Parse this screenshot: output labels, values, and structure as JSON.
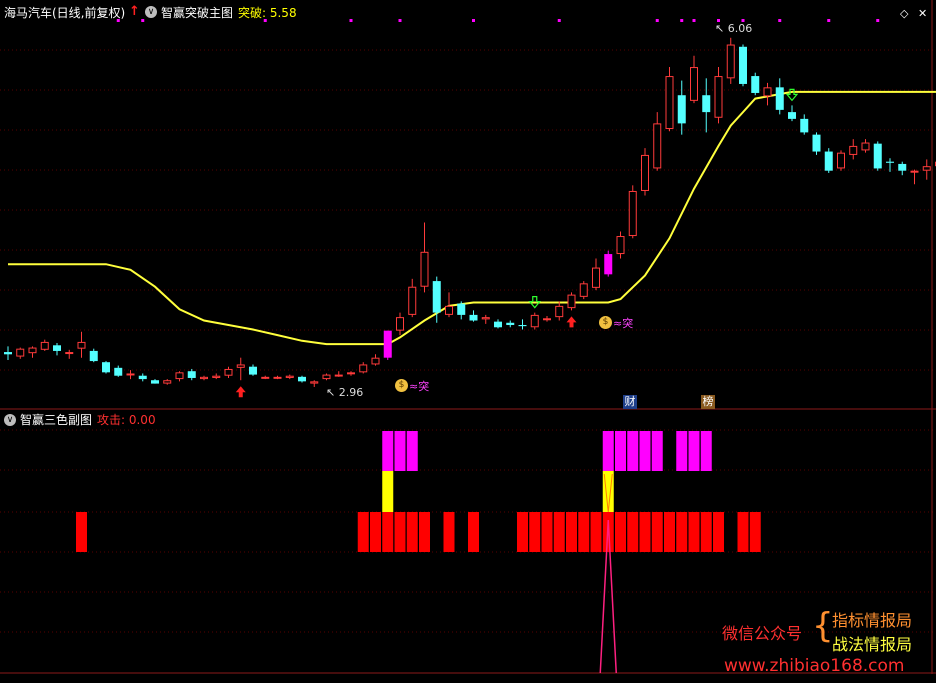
{
  "colors": {
    "background": "#000000",
    "grid": "#5a0000",
    "border": "#8b1a1a",
    "up": "#ff3b3b",
    "down": "#54ffff",
    "ma_line": "#ffff3c",
    "magenta": "#ff00ff",
    "yellow": "#ffff00",
    "red_bar": "#ff0000",
    "header_text": "#ffffff",
    "breakout_label": "#ffff00",
    "attack_label": "#ff3030"
  },
  "main_panel": {
    "stock_title": "海马汽车(日线,前复权)",
    "title_arrow_icon": "red-up-arrow-icon",
    "indicator_name": "智赢突破主图",
    "breakout_label": "突破: 5.58",
    "high_label": "6.06",
    "low_label": "2.96",
    "signal_text": "突",
    "signal_icon": "money-bag-icon",
    "event_cai": "财",
    "event_bang": "榜",
    "controls": [
      "◇",
      "✕"
    ]
  },
  "sub_panel": {
    "indicator_name": "智赢三色副图",
    "attack_label": "攻击: 0.00"
  },
  "watermark": {
    "channel_label": "微信公众号",
    "name_1": "指标情报局",
    "name_2": "战法情报局",
    "url": "www.zhibiao168.com"
  },
  "chart_data": [
    {
      "type": "candlestick",
      "title": "智赢突破主图",
      "subject": "海马汽车(日线,前复权)",
      "ylim": [
        2.8,
        6.2
      ],
      "annotations": [
        {
          "text": "6.06",
          "value": 6.06,
          "kind": "high"
        },
        {
          "text": "2.96",
          "value": 2.96,
          "kind": "low"
        }
      ],
      "candles": [
        {
          "o": 3.27,
          "h": 3.32,
          "l": 3.2,
          "c": 3.25
        },
        {
          "o": 3.23,
          "h": 3.31,
          "l": 3.21,
          "c": 3.3
        },
        {
          "o": 3.26,
          "h": 3.32,
          "l": 3.22,
          "c": 3.31
        },
        {
          "o": 3.29,
          "h": 3.38,
          "l": 3.28,
          "c": 3.36
        },
        {
          "o": 3.33,
          "h": 3.35,
          "l": 3.24,
          "c": 3.28
        },
        {
          "o": 3.26,
          "h": 3.29,
          "l": 3.21,
          "c": 3.27
        },
        {
          "o": 3.3,
          "h": 3.45,
          "l": 3.22,
          "c": 3.36
        },
        {
          "o": 3.28,
          "h": 3.3,
          "l": 3.18,
          "c": 3.19
        },
        {
          "o": 3.18,
          "h": 3.19,
          "l": 3.08,
          "c": 3.09
        },
        {
          "o": 3.13,
          "h": 3.15,
          "l": 3.05,
          "c": 3.06
        },
        {
          "o": 3.08,
          "h": 3.11,
          "l": 3.03,
          "c": 3.08
        },
        {
          "o": 3.06,
          "h": 3.08,
          "l": 3.01,
          "c": 3.03
        },
        {
          "o": 3.02,
          "h": 3.03,
          "l": 2.99,
          "c": 2.99
        },
        {
          "o": 2.99,
          "h": 3.03,
          "l": 2.98,
          "c": 3.02
        },
        {
          "o": 3.03,
          "h": 3.1,
          "l": 3.01,
          "c": 3.09
        },
        {
          "o": 3.1,
          "h": 3.12,
          "l": 3.02,
          "c": 3.04
        },
        {
          "o": 3.03,
          "h": 3.06,
          "l": 3.02,
          "c": 3.05
        },
        {
          "o": 3.04,
          "h": 3.08,
          "l": 3.03,
          "c": 3.06
        },
        {
          "o": 3.06,
          "h": 3.14,
          "l": 3.04,
          "c": 3.12
        },
        {
          "o": 3.13,
          "h": 3.22,
          "l": 3.02,
          "c": 3.16
        },
        {
          "o": 3.14,
          "h": 3.16,
          "l": 3.06,
          "c": 3.07
        },
        {
          "o": 3.05,
          "h": 3.06,
          "l": 3.03,
          "c": 3.05
        },
        {
          "o": 3.05,
          "h": 3.06,
          "l": 3.03,
          "c": 3.05
        },
        {
          "o": 3.04,
          "h": 3.07,
          "l": 3.03,
          "c": 3.06
        },
        {
          "o": 3.05,
          "h": 3.06,
          "l": 3.0,
          "c": 3.01
        },
        {
          "o": 2.99,
          "h": 3.02,
          "l": 2.96,
          "c": 3.01
        },
        {
          "o": 3.03,
          "h": 3.08,
          "l": 3.02,
          "c": 3.07
        },
        {
          "o": 3.07,
          "h": 3.1,
          "l": 3.05,
          "c": 3.07
        },
        {
          "o": 3.08,
          "h": 3.1,
          "l": 3.06,
          "c": 3.09
        },
        {
          "o": 3.09,
          "h": 3.18,
          "l": 3.08,
          "c": 3.16
        },
        {
          "o": 3.16,
          "h": 3.25,
          "l": 3.15,
          "c": 3.22
        },
        {
          "o": 3.22,
          "h": 3.46,
          "l": 3.2,
          "c": 3.46,
          "hl": "magenta"
        },
        {
          "o": 3.46,
          "h": 3.62,
          "l": 3.42,
          "c": 3.58
        },
        {
          "o": 3.6,
          "h": 3.92,
          "l": 3.58,
          "c": 3.85
        },
        {
          "o": 3.85,
          "h": 4.42,
          "l": 3.8,
          "c": 4.16
        },
        {
          "o": 3.9,
          "h": 3.94,
          "l": 3.53,
          "c": 3.62
        },
        {
          "o": 3.6,
          "h": 3.8,
          "l": 3.58,
          "c": 3.68
        },
        {
          "o": 3.7,
          "h": 3.72,
          "l": 3.56,
          "c": 3.6
        },
        {
          "o": 3.6,
          "h": 3.64,
          "l": 3.54,
          "c": 3.55
        },
        {
          "o": 3.56,
          "h": 3.6,
          "l": 3.52,
          "c": 3.58
        },
        {
          "o": 3.54,
          "h": 3.56,
          "l": 3.48,
          "c": 3.49
        },
        {
          "o": 3.53,
          "h": 3.55,
          "l": 3.49,
          "c": 3.51
        },
        {
          "o": 3.51,
          "h": 3.56,
          "l": 3.47,
          "c": 3.5
        },
        {
          "o": 3.49,
          "h": 3.62,
          "l": 3.47,
          "c": 3.6
        },
        {
          "o": 3.56,
          "h": 3.59,
          "l": 3.54,
          "c": 3.57
        },
        {
          "o": 3.58,
          "h": 3.72,
          "l": 3.55,
          "c": 3.68
        },
        {
          "o": 3.66,
          "h": 3.8,
          "l": 3.64,
          "c": 3.78
        },
        {
          "o": 3.76,
          "h": 3.9,
          "l": 3.74,
          "c": 3.88
        },
        {
          "o": 3.84,
          "h": 4.1,
          "l": 3.82,
          "c": 4.02
        },
        {
          "o": 3.96,
          "h": 4.17,
          "l": 3.94,
          "c": 4.14,
          "hl": "magenta"
        },
        {
          "o": 4.14,
          "h": 4.34,
          "l": 4.1,
          "c": 4.3
        },
        {
          "o": 4.3,
          "h": 4.75,
          "l": 4.28,
          "c": 4.7
        },
        {
          "o": 4.7,
          "h": 5.08,
          "l": 4.66,
          "c": 5.02
        },
        {
          "o": 4.9,
          "h": 5.4,
          "l": 4.88,
          "c": 5.3
        },
        {
          "o": 5.25,
          "h": 5.8,
          "l": 5.23,
          "c": 5.72
        },
        {
          "o": 5.55,
          "h": 5.68,
          "l": 5.2,
          "c": 5.3
        },
        {
          "o": 5.5,
          "h": 5.9,
          "l": 5.48,
          "c": 5.8
        },
        {
          "o": 5.55,
          "h": 5.7,
          "l": 5.22,
          "c": 5.4
        },
        {
          "o": 5.35,
          "h": 5.8,
          "l": 5.3,
          "c": 5.72
        },
        {
          "o": 5.7,
          "h": 6.06,
          "l": 5.65,
          "c": 6.0
        },
        {
          "o": 5.98,
          "h": 6.0,
          "l": 5.63,
          "c": 5.65
        },
        {
          "o": 5.72,
          "h": 5.75,
          "l": 5.55,
          "c": 5.57
        },
        {
          "o": 5.54,
          "h": 5.66,
          "l": 5.46,
          "c": 5.62
        },
        {
          "o": 5.62,
          "h": 5.7,
          "l": 5.38,
          "c": 5.42
        },
        {
          "o": 5.4,
          "h": 5.46,
          "l": 5.32,
          "c": 5.34
        },
        {
          "o": 5.34,
          "h": 5.38,
          "l": 5.2,
          "c": 5.22
        },
        {
          "o": 5.2,
          "h": 5.22,
          "l": 5.02,
          "c": 5.05
        },
        {
          "o": 5.05,
          "h": 5.08,
          "l": 4.86,
          "c": 4.88
        },
        {
          "o": 4.9,
          "h": 5.06,
          "l": 4.88,
          "c": 5.04
        },
        {
          "o": 5.02,
          "h": 5.16,
          "l": 4.98,
          "c": 5.1
        },
        {
          "o": 5.06,
          "h": 5.16,
          "l": 5.04,
          "c": 5.13
        },
        {
          "o": 5.12,
          "h": 5.14,
          "l": 4.88,
          "c": 4.9
        },
        {
          "o": 4.96,
          "h": 4.99,
          "l": 4.87,
          "c": 4.95
        },
        {
          "o": 4.94,
          "h": 4.96,
          "l": 4.84,
          "c": 4.88
        },
        {
          "o": 4.88,
          "h": 4.89,
          "l": 4.76,
          "c": 4.88
        },
        {
          "o": 4.88,
          "h": 4.98,
          "l": 4.8,
          "c": 4.92
        },
        {
          "o": 4.92,
          "h": 5.0,
          "l": 4.82,
          "c": 4.96
        }
      ],
      "ma_line": [
        [
          0,
          4.05
        ],
        [
          8,
          4.05
        ],
        [
          10,
          4.0
        ],
        [
          12,
          3.85
        ],
        [
          14,
          3.65
        ],
        [
          16,
          3.55
        ],
        [
          18,
          3.51
        ],
        [
          20,
          3.47
        ],
        [
          22,
          3.42
        ],
        [
          24,
          3.37
        ],
        [
          26,
          3.34
        ],
        [
          28,
          3.34
        ],
        [
          30,
          3.34
        ],
        [
          31,
          3.34
        ],
        [
          32,
          3.4
        ],
        [
          34,
          3.55
        ],
        [
          36,
          3.68
        ],
        [
          38,
          3.71
        ],
        [
          40,
          3.71
        ],
        [
          44,
          3.71
        ],
        [
          48,
          3.71
        ],
        [
          49,
          3.71
        ],
        [
          50,
          3.74
        ],
        [
          52,
          3.95
        ],
        [
          54,
          4.28
        ],
        [
          56,
          4.72
        ],
        [
          58,
          5.1
        ],
        [
          59,
          5.28
        ],
        [
          60,
          5.4
        ],
        [
          61,
          5.52
        ],
        [
          62,
          5.54
        ],
        [
          63,
          5.56
        ],
        [
          64,
          5.58
        ],
        [
          70,
          5.58
        ],
        [
          77,
          5.58
        ]
      ],
      "signals": {
        "up_arrows": [
          19,
          46
        ],
        "down_arrows": [
          43,
          64
        ],
        "breakout_markers": [
          31,
          49
        ]
      }
    },
    {
      "type": "bar",
      "title": "智赢三色副图",
      "series": [
        {
          "color": "red",
          "indices": [
            6,
            29,
            30,
            31,
            32,
            33,
            34,
            36,
            38,
            42,
            43,
            44,
            45,
            46,
            47,
            48,
            49,
            50,
            51,
            52,
            53,
            54,
            55,
            56,
            57,
            58,
            60,
            61
          ]
        },
        {
          "color": "yellow",
          "indices": [
            31,
            49
          ]
        },
        {
          "color": "magenta",
          "indices": [
            31,
            32,
            33,
            49,
            50,
            51,
            52,
            53,
            55,
            56,
            57
          ]
        }
      ],
      "spike": {
        "index": 49,
        "from": 0,
        "to": 1
      }
    }
  ]
}
